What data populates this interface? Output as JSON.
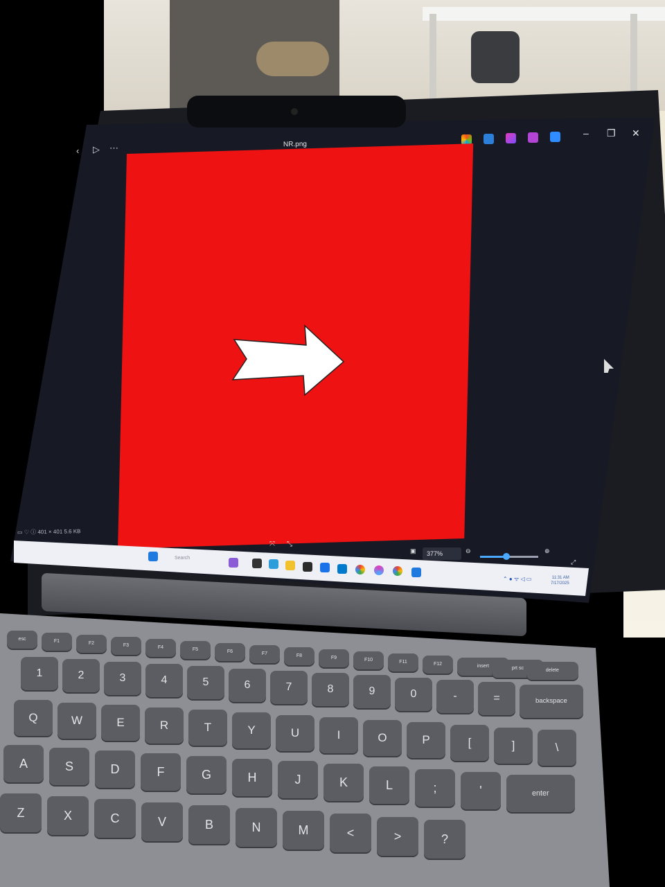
{
  "viewer": {
    "file_name": "NR.png",
    "image_info": "401 × 401",
    "file_size": "5.6 KB",
    "zoom": "377%",
    "zoom_fraction": 0.45
  },
  "taskbar": {
    "search_placeholder": "Search",
    "time": "11:31 AM",
    "date": "7/17/2025"
  },
  "keyboard": {
    "fn_row": [
      "esc",
      "F1",
      "F2",
      "F3",
      "F4",
      "F5",
      "F6",
      "F7",
      "F8",
      "F9",
      "F10",
      "F11",
      "F12",
      "insert",
      "prt sc",
      "delete"
    ],
    "num_row": [
      "1",
      "2",
      "3",
      "4",
      "5",
      "6",
      "7",
      "8",
      "9",
      "0",
      "-",
      "=",
      "backspace"
    ],
    "q_row": [
      "Q",
      "W",
      "E",
      "R",
      "T",
      "Y",
      "U",
      "I",
      "O",
      "P",
      "[",
      "]",
      "\\"
    ],
    "a_row": [
      "A",
      "S",
      "D",
      "F",
      "G",
      "H",
      "J",
      "K",
      "L",
      ";",
      "'",
      "enter"
    ],
    "z_row": [
      "Z",
      "X",
      "C",
      "V",
      "B",
      "N",
      "M",
      "<",
      ">",
      "?"
    ]
  },
  "colors": {
    "image_red": "#ee1212",
    "arrow": "#ffffff",
    "accent": "#4aa9ff"
  },
  "icons": [
    "more-icon",
    "play-icon",
    "minimize-icon",
    "maximize-icon",
    "close-icon",
    "zoom-in-icon",
    "zoom-out-icon",
    "fullscreen-icon",
    "windows-start-icon"
  ]
}
